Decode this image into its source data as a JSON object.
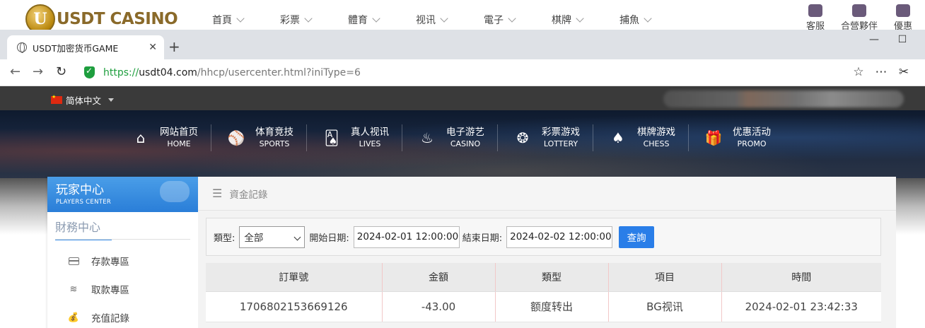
{
  "site": {
    "logo_text": "USDT CASINO",
    "logo_letter": "U",
    "menu": [
      "首頁",
      "彩票",
      "體育",
      "视讯",
      "電子",
      "棋牌",
      "捕魚"
    ],
    "right_items": [
      "客服",
      "合營夥伴",
      "優惠"
    ]
  },
  "browser": {
    "tab_title": "USDT加密货币GAME",
    "url_scheme": "https://",
    "url_host": "usdt04.com",
    "url_path": "/hhcp/usercenter.html?iniType=6"
  },
  "topbar": {
    "language": "简体中文"
  },
  "nav": [
    {
      "cn": "网站首页",
      "en": "HOME",
      "icon": "home-icon"
    },
    {
      "cn": "体育竞技",
      "en": "SPORTS",
      "icon": "ball-icon"
    },
    {
      "cn": "真人视讯",
      "en": "LIVES",
      "icon": "cards-icon"
    },
    {
      "cn": "电子游艺",
      "en": "CASINO",
      "icon": "slot-icon"
    },
    {
      "cn": "彩票游戏",
      "en": "LOTTERY",
      "icon": "lottery-icon"
    },
    {
      "cn": "棋牌游戏",
      "en": "CHESS",
      "icon": "spade-icon"
    },
    {
      "cn": "优惠活动",
      "en": "PROMO",
      "icon": "gift-icon"
    }
  ],
  "sidebar": {
    "title": "玩家中心",
    "subtitle": "PLAYERS CENTER",
    "section": "財務中心",
    "items": [
      {
        "label": "存款專區",
        "icon": "card-icon"
      },
      {
        "label": "取款專區",
        "icon": "withdraw-icon"
      },
      {
        "label": "充值記錄",
        "icon": "moneybag-icon"
      }
    ]
  },
  "main": {
    "header": "資金記錄",
    "filter": {
      "type_label": "類型:",
      "type_value": "全部",
      "start_label": "開始日期:",
      "start_value": "2024-02-01 12:00:00",
      "end_label": "結束日期:",
      "end_value": "2024-02-02 12:00:00",
      "query_button": "查詢"
    },
    "table": {
      "headers": [
        "訂單號",
        "金額",
        "類型",
        "項目",
        "時間"
      ],
      "rows": [
        [
          "1706802153669126",
          "-43.00",
          "额度转出",
          "BG视讯",
          "2024-02-01 23:42:33"
        ]
      ]
    }
  }
}
